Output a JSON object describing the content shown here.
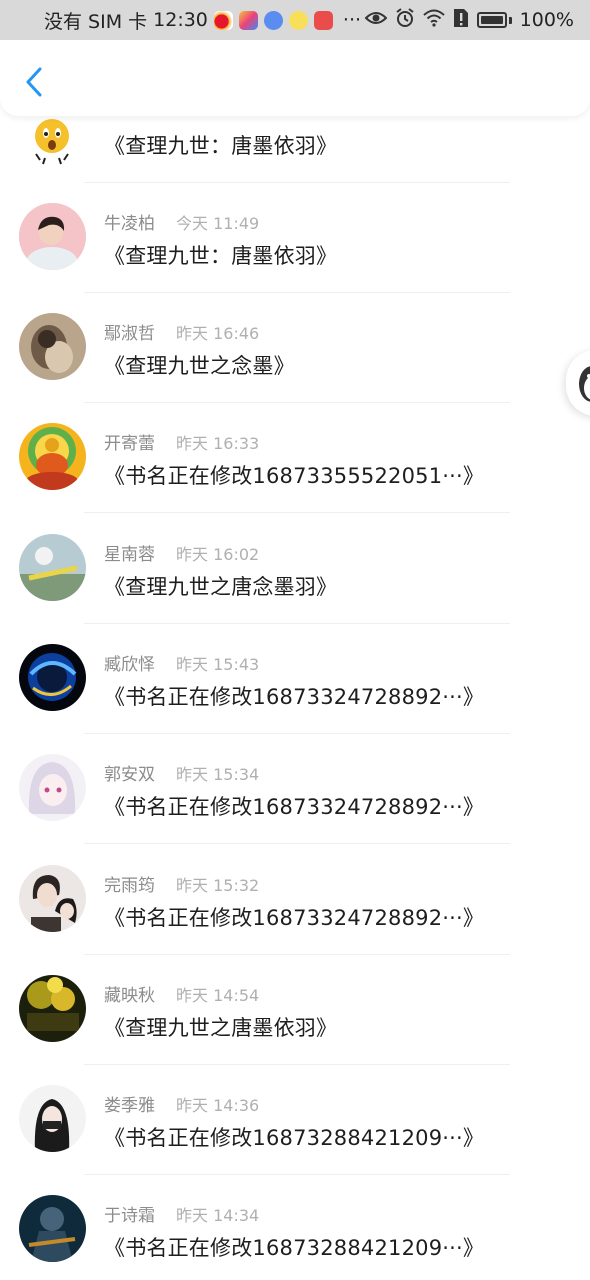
{
  "status_bar": {
    "carrier": "没有 SIM 卡",
    "time": "12:30",
    "more": "···",
    "battery": "100%"
  },
  "header": {
    "back_icon": "chevron-left-icon",
    "accent_color": "#2196f3"
  },
  "messages": [
    {
      "name": "",
      "time": "",
      "text": "《查理九世：唐墨依羽》",
      "avatar": "emoji-face"
    },
    {
      "name": "牛凌柏",
      "time": "今天 11:49",
      "text": "《查理九世：唐墨依羽》",
      "avatar": "pink-portrait"
    },
    {
      "name": "鄢淑哲",
      "time": "昨天 16:46",
      "text": "《查理九世之念墨》",
      "avatar": "sepia-photo"
    },
    {
      "name": "开寄蕾",
      "time": "昨天 16:33",
      "text": "《书名正在修改16873355522051···》",
      "avatar": "golden-buddha"
    },
    {
      "name": "星南蓉",
      "time": "昨天 16:02",
      "text": "《查理九世之唐念墨羽》",
      "avatar": "flower-photo"
    },
    {
      "name": "臧欣怿",
      "time": "昨天 15:43",
      "text": "《书名正在修改16873324728892···》",
      "avatar": "blue-orb"
    },
    {
      "name": "郭安双",
      "time": "昨天 15:34",
      "text": "《书名正在修改16873324728892···》",
      "avatar": "anime-girl"
    },
    {
      "name": "完雨筠",
      "time": "昨天 15:32",
      "text": "《书名正在修改16873324728892···》",
      "avatar": "anime-couple"
    },
    {
      "name": "藏映秋",
      "time": "昨天 14:54",
      "text": "《查理九世之唐墨依羽》",
      "avatar": "forest-lights"
    },
    {
      "name": "娄季雅",
      "time": "昨天 14:36",
      "text": "《书名正在修改16873288421209···》",
      "avatar": "dark-hair-girl"
    },
    {
      "name": "于诗霜",
      "time": "昨天 14:34",
      "text": "《书名正在修改16873288421209···》",
      "avatar": "armored-warrior"
    }
  ]
}
